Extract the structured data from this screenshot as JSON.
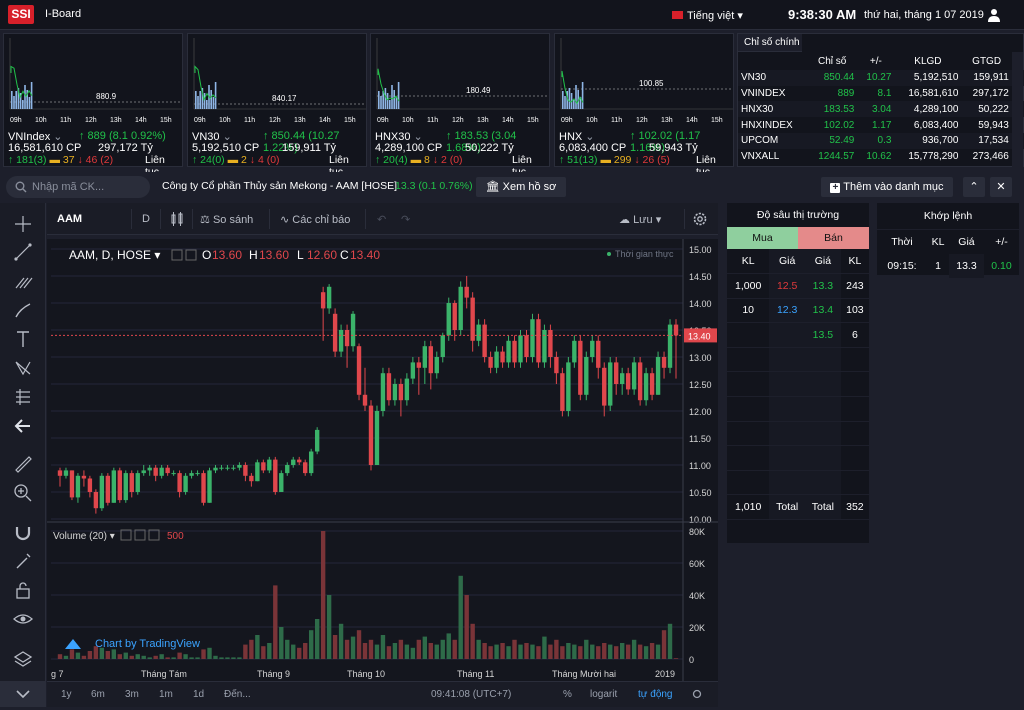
{
  "header": {
    "logo": "SSI",
    "app_name": "I-Board",
    "language": "Tiếng việt",
    "time": "9:38:30 AM",
    "date": "thứ hai, tháng 1 07 2019"
  },
  "mini_charts": [
    {
      "name": "VNIndex",
      "change": "↑ 889 (8.1 0.92%)",
      "volume": "16,581,610 CP",
      "value": "297,172 Tỷ",
      "up": "↑ 181(3)",
      "ref": "▬ 37",
      "down": "↓ 46 (2)",
      "status": "Liên tục",
      "ref_price": "880.9",
      "times": [
        "09h",
        "10h",
        "11h",
        "12h",
        "13h",
        "14h",
        "15h"
      ]
    },
    {
      "name": "VN30",
      "change": "↑ 850.44 (10.27 1.22%)",
      "volume": "5,192,510 CP",
      "value": "159,911 Tỷ",
      "up": "↑ 24(0)",
      "ref": "▬ 2",
      "down": "↓ 4 (0)",
      "status": "Liên tục",
      "ref_price": "840.17",
      "times": [
        "09h",
        "10h",
        "11h",
        "12h",
        "13h",
        "14h",
        "15h"
      ]
    },
    {
      "name": "HNX30",
      "change": "↑ 183.53 (3.04 1.68%)",
      "volume": "4,289,100 CP",
      "value": "50,222 Tỷ",
      "up": "↑ 20(4)",
      "ref": "▬ 8",
      "down": "↓ 2 (0)",
      "status": "Liên tục",
      "ref_price": "180.49",
      "times": [
        "09h",
        "10h",
        "11h",
        "12h",
        "13h",
        "14h",
        "15h"
      ]
    },
    {
      "name": "HNX",
      "change": "↑ 102.02 (1.17 1.16%)",
      "volume": "6,083,400 CP",
      "value": "59,943 Tỷ",
      "up": "↑ 51(13)",
      "ref": "▬ 299",
      "down": "↓ 26 (5)",
      "status": "Liên tục",
      "ref_price": "100.85",
      "times": [
        "09h",
        "10h",
        "11h",
        "12h",
        "13h",
        "14h",
        "15h"
      ]
    }
  ],
  "index_panel": {
    "tab": "Chỉ số chính",
    "headers": [
      "",
      "Chỉ số",
      "+/-",
      "KLGD",
      "GTGD"
    ],
    "rows": [
      [
        "VN30",
        "850.44",
        "10.27",
        "5,192,510",
        "159,911"
      ],
      [
        "VNINDEX",
        "889",
        "8.1",
        "16,581,610",
        "297,172"
      ],
      [
        "HNX30",
        "183.53",
        "3.04",
        "4,289,100",
        "50,222"
      ],
      [
        "HNXINDEX",
        "102.02",
        "1.17",
        "6,083,400",
        "59,943"
      ],
      [
        "UPCOM",
        "52.49",
        "0.3",
        "936,700",
        "17,534"
      ],
      [
        "VNXALL",
        "1244.57",
        "10.62",
        "15,778,290",
        "273,466"
      ]
    ]
  },
  "symbol_bar": {
    "search_placeholder": "Nhập mã CK...",
    "company": "Công ty Cổ phần Thủy sản Mekong - AAM [HOSE]",
    "price_change": "13.3 (0.1 0.76%)",
    "profile_button": "Xem hồ sơ",
    "watchlist_button": "Thêm vào danh mục"
  },
  "chart_toolbar": {
    "symbol": "AAM",
    "interval": "D",
    "compare": "So sánh",
    "indicators": "Các chỉ báo",
    "save": "Lưu"
  },
  "chart_data": {
    "type": "candlestick",
    "legend": "AAM, D, HOSE",
    "ohlc_labels": {
      "o": "O",
      "o_val": "13.60",
      "h": "H",
      "h_val": "13.60",
      "l": "L",
      "l_val": "12.60",
      "c": "C",
      "c_val": "13.40"
    },
    "realtime_label": "Thời gian thực",
    "last_price": "13.40",
    "price_ticks": [
      "15.00",
      "14.50",
      "14.00",
      "13.50",
      "13.00",
      "12.50",
      "12.00",
      "11.50",
      "11.00",
      "10.50",
      "10.00"
    ],
    "ylim": [
      10.0,
      15.0
    ],
    "volume_label": "Volume (20)",
    "volume_value": "500",
    "volume_ticks": [
      "80K",
      "60K",
      "40K",
      "20K",
      "0"
    ],
    "volume_ylim": [
      0,
      80000
    ],
    "x_labels": [
      "g 7",
      "Tháng Tám",
      "Tháng 9",
      "Tháng 10",
      "Tháng 11",
      "Tháng Mười hai",
      "2019"
    ],
    "candles": [
      [
        10.9,
        10.8,
        10.95,
        10.6
      ],
      [
        10.8,
        10.9,
        10.95,
        10.75
      ],
      [
        10.9,
        10.4,
        10.9,
        10.35
      ],
      [
        10.4,
        10.8,
        10.85,
        10.3
      ],
      [
        10.8,
        10.75,
        10.9,
        10.6
      ],
      [
        10.75,
        10.5,
        10.8,
        10.4
      ],
      [
        10.5,
        10.2,
        10.55,
        10.1
      ],
      [
        10.2,
        10.8,
        10.85,
        10.15
      ],
      [
        10.8,
        10.3,
        10.85,
        10.25
      ],
      [
        10.3,
        10.9,
        10.95,
        10.3
      ],
      [
        10.9,
        10.35,
        10.95,
        10.3
      ],
      [
        10.35,
        10.85,
        10.9,
        10.3
      ],
      [
        10.85,
        10.5,
        10.9,
        10.4
      ],
      [
        10.5,
        10.85,
        10.9,
        10.45
      ],
      [
        10.85,
        10.9,
        11.0,
        10.8
      ],
      [
        10.9,
        10.95,
        11.0,
        10.8
      ],
      [
        10.95,
        10.8,
        11.0,
        10.7
      ],
      [
        10.8,
        10.95,
        11.0,
        10.75
      ],
      [
        10.95,
        10.85,
        11.0,
        10.8
      ],
      [
        10.85,
        10.85,
        10.9,
        10.8
      ],
      [
        10.85,
        10.5,
        10.9,
        10.4
      ],
      [
        10.5,
        10.8,
        10.85,
        10.45
      ],
      [
        10.8,
        10.85,
        10.9,
        10.75
      ],
      [
        10.85,
        10.85,
        10.9,
        10.8
      ],
      [
        10.85,
        10.3,
        10.9,
        10.25
      ],
      [
        10.3,
        10.9,
        10.95,
        10.3
      ],
      [
        10.9,
        10.95,
        11.0,
        10.85
      ],
      [
        10.95,
        10.95,
        11.0,
        10.9
      ],
      [
        10.95,
        10.95,
        11.0,
        10.9
      ],
      [
        10.95,
        10.95,
        11.0,
        10.9
      ],
      [
        10.95,
        11.0,
        11.05,
        10.9
      ],
      [
        11.0,
        10.8,
        11.05,
        10.7
      ],
      [
        10.8,
        10.7,
        10.85,
        10.6
      ],
      [
        10.7,
        11.05,
        11.1,
        10.7
      ],
      [
        11.05,
        10.9,
        11.1,
        10.85
      ],
      [
        10.9,
        11.1,
        11.15,
        10.85
      ],
      [
        11.1,
        10.5,
        11.15,
        10.45
      ],
      [
        10.5,
        10.85,
        10.9,
        10.5
      ],
      [
        10.85,
        11.0,
        11.05,
        10.8
      ],
      [
        11.0,
        11.1,
        11.15,
        10.95
      ],
      [
        11.1,
        11.05,
        11.15,
        11.0
      ],
      [
        11.05,
        10.85,
        11.1,
        10.8
      ],
      [
        10.85,
        11.25,
        11.3,
        10.8
      ],
      [
        11.25,
        11.65,
        11.7,
        11.2
      ],
      [
        14.2,
        13.9,
        14.3,
        13.3
      ],
      [
        13.9,
        14.3,
        14.35,
        13.8
      ],
      [
        13.8,
        13.1,
        13.9,
        13.0
      ],
      [
        13.1,
        13.5,
        13.6,
        13.0
      ],
      [
        13.5,
        13.2,
        13.6,
        12.8
      ],
      [
        13.2,
        13.8,
        13.85,
        13.1
      ],
      [
        13.2,
        12.3,
        13.25,
        12.2
      ],
      [
        12.3,
        12.1,
        12.8,
        12.0
      ],
      [
        12.1,
        11.0,
        12.2,
        10.9
      ],
      [
        11.0,
        12.0,
        12.1,
        11.0
      ],
      [
        12.0,
        12.7,
        12.8,
        11.9
      ],
      [
        12.7,
        12.2,
        12.8,
        12.1
      ],
      [
        12.2,
        12.5,
        12.6,
        12.1
      ],
      [
        12.5,
        12.2,
        12.6,
        11.9
      ],
      [
        12.2,
        12.6,
        12.7,
        12.1
      ],
      [
        12.6,
        12.9,
        13.0,
        12.5
      ],
      [
        12.9,
        12.8,
        13.0,
        12.3
      ],
      [
        12.8,
        13.2,
        13.3,
        12.5
      ],
      [
        13.2,
        12.7,
        13.3,
        12.4
      ],
      [
        12.7,
        13.0,
        13.1,
        12.6
      ],
      [
        13.0,
        13.4,
        13.45,
        12.9
      ],
      [
        13.4,
        14.0,
        14.1,
        13.3
      ],
      [
        14.0,
        13.5,
        14.05,
        13.3
      ],
      [
        13.5,
        14.3,
        14.4,
        13.4
      ],
      [
        14.3,
        14.1,
        14.5,
        13.9
      ],
      [
        14.1,
        13.3,
        14.2,
        13.1
      ],
      [
        13.3,
        13.6,
        13.7,
        13.2
      ],
      [
        13.6,
        13.0,
        13.7,
        12.9
      ],
      [
        13.0,
        12.8,
        13.1,
        12.7
      ],
      [
        12.8,
        13.1,
        13.2,
        12.7
      ],
      [
        13.1,
        12.9,
        13.2,
        12.8
      ],
      [
        12.9,
        13.3,
        13.4,
        12.8
      ],
      [
        13.3,
        12.9,
        13.4,
        12.8
      ],
      [
        12.9,
        13.4,
        13.5,
        12.8
      ],
      [
        13.4,
        13.0,
        13.5,
        12.9
      ],
      [
        13.0,
        13.7,
        13.8,
        12.9
      ],
      [
        13.7,
        12.9,
        13.8,
        12.8
      ],
      [
        12.9,
        13.5,
        13.6,
        12.8
      ],
      [
        13.5,
        13.0,
        13.6,
        12.8
      ],
      [
        13.0,
        12.7,
        13.1,
        12.5
      ],
      [
        12.7,
        12.0,
        12.8,
        11.9
      ],
      [
        12.0,
        12.9,
        13.0,
        11.9
      ],
      [
        12.9,
        13.3,
        13.4,
        12.8
      ],
      [
        13.3,
        12.3,
        13.4,
        12.2
      ],
      [
        12.3,
        13.0,
        13.1,
        12.2
      ],
      [
        13.0,
        13.3,
        13.4,
        12.9
      ],
      [
        13.3,
        12.8,
        13.4,
        12.6
      ],
      [
        12.8,
        12.1,
        12.9,
        11.9
      ],
      [
        12.1,
        12.9,
        13.0,
        12.0
      ],
      [
        12.9,
        12.5,
        13.0,
        12.3
      ],
      [
        12.5,
        12.7,
        12.8,
        12.3
      ],
      [
        12.7,
        12.4,
        12.8,
        12.3
      ],
      [
        12.4,
        12.9,
        13.0,
        12.3
      ],
      [
        12.9,
        12.2,
        13.0,
        12.1
      ],
      [
        12.2,
        12.7,
        12.8,
        12.1
      ],
      [
        12.7,
        12.3,
        12.8,
        12.2
      ],
      [
        12.3,
        13.0,
        13.1,
        12.3
      ],
      [
        13.0,
        12.8,
        13.1,
        12.6
      ],
      [
        12.8,
        13.6,
        13.7,
        12.7
      ],
      [
        13.6,
        13.4,
        13.7,
        12.6
      ]
    ],
    "volumes": [
      3000,
      2000,
      6000,
      4000,
      2000,
      5000,
      8000,
      7000,
      5000,
      6000,
      3000,
      4000,
      2000,
      3000,
      2000,
      1000,
      2000,
      3000,
      1000,
      1000,
      4000,
      3000,
      1000,
      1000,
      6000,
      7000,
      2000,
      1000,
      1000,
      1000,
      1000,
      9000,
      12000,
      15000,
      8000,
      10000,
      46000,
      20000,
      12000,
      9000,
      7000,
      10000,
      18000,
      25000,
      80000,
      40000,
      15000,
      22000,
      12000,
      14000,
      18000,
      10000,
      12000,
      9000,
      15000,
      8000,
      10000,
      12000,
      9000,
      7000,
      12000,
      14000,
      10000,
      9000,
      12000,
      16000,
      12000,
      52000,
      40000,
      22000,
      12000,
      10000,
      8000,
      9000,
      10000,
      8000,
      12000,
      9000,
      10000,
      9000,
      8000,
      14000,
      9000,
      12000,
      8000,
      10000,
      9000,
      8000,
      12000,
      9000,
      8000,
      10000,
      9000,
      8000,
      10000,
      9000,
      12000,
      9000,
      8000,
      10000,
      9000,
      18000,
      22000,
      500
    ]
  },
  "bottom_bar": {
    "ranges": [
      "1y",
      "6m",
      "3m",
      "1m",
      "1d",
      "Đến..."
    ],
    "time": "09:41:08 (UTC+7)",
    "percent": "%",
    "log": "logarit",
    "auto": "tự động"
  },
  "tradingview": "Chart by TradingView",
  "depth": {
    "title": "Độ sâu thị trường",
    "buy": "Mua",
    "sell": "Bán",
    "headers": [
      "KL",
      "Giá",
      "Giá",
      "KL"
    ],
    "rows": [
      [
        "1,000",
        "12.5",
        "13.3",
        "243"
      ],
      [
        "10",
        "12.3",
        "13.4",
        "103"
      ],
      [
        "",
        "",
        "13.5",
        "6"
      ],
      [
        "",
        "",
        "",
        ""
      ],
      [
        "",
        "",
        "",
        ""
      ],
      [
        "",
        "",
        "",
        ""
      ],
      [
        "",
        "",
        "",
        ""
      ],
      [
        "",
        "",
        "",
        ""
      ],
      [
        "",
        "",
        "",
        ""
      ]
    ],
    "total": [
      "1,010",
      "Total",
      "Total",
      "352"
    ]
  },
  "matched": {
    "title": "Khớp lệnh",
    "headers": [
      "Thời",
      "KL",
      "Giá",
      "+/-"
    ],
    "row": [
      "09:15:",
      "1",
      "13.3",
      "0.10"
    ]
  },
  "colors": {
    "up": "#21c24a",
    "down": "#e0393b",
    "ref": "#e8b021",
    "bg": "#1d1f2b"
  }
}
